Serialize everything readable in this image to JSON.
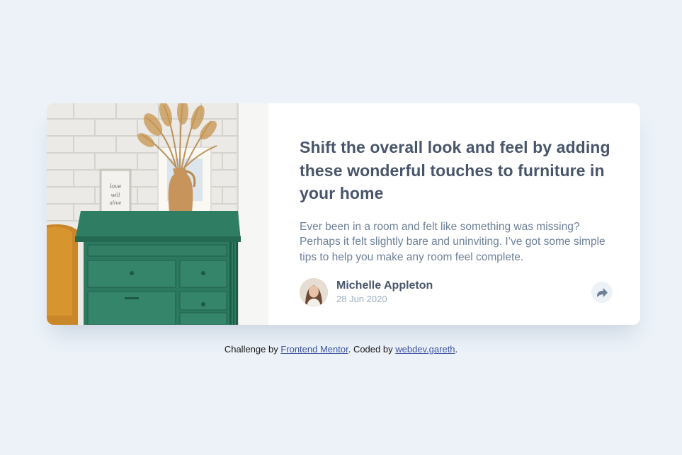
{
  "card": {
    "image_alt": "drawers",
    "title": "Shift the overall look and feel by adding these wonderful touches to furniture in your home",
    "description": "Ever been in a room and felt like something was missing? Perhaps it felt slightly bare and uninviting. I’ve got some simple tips to help you make any room feel complete.",
    "author": {
      "name": "Michelle Appleton",
      "date": "28 Jun 2020"
    },
    "share_icon": "share-icon"
  },
  "attribution": {
    "prefix": "Challenge by ",
    "link1": "Frontend Mentor",
    "middle": ". Coded by ",
    "link2": "webdev.gareth",
    "suffix": "."
  },
  "colors": {
    "background": "#ecf2f8",
    "title": "#48556a",
    "body_text": "#6e8098",
    "muted": "#9eafc2",
    "link": "#3e52a3"
  }
}
